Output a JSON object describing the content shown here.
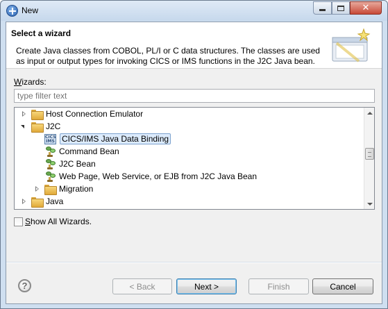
{
  "window": {
    "title": "New"
  },
  "header": {
    "title": "Select a wizard",
    "description": "Create Java classes from COBOL, PL/I or C data structures. The classes are used as input or output types for invoking CICS or IMS functions in the J2C Java bean."
  },
  "wizards": {
    "label_prefix": "W",
    "label_rest": "izards:",
    "filter_placeholder": "type filter text",
    "items": [
      {
        "label": "Host Connection Emulator",
        "icon": "folder-icon",
        "state": "collapsed"
      },
      {
        "label": "J2C",
        "icon": "folder-icon",
        "state": "expanded"
      },
      {
        "label": "CICS/IMS Java Data Binding",
        "icon": "cics-ims-icon",
        "selected": true
      },
      {
        "label": "Command Bean",
        "icon": "bean-icon"
      },
      {
        "label": "J2C Bean",
        "icon": "bean-icon"
      },
      {
        "label": "Web Page, Web Service, or EJB from J2C Java Bean",
        "icon": "bean-icon"
      },
      {
        "label": "Migration",
        "icon": "folder-icon",
        "state": "collapsed"
      },
      {
        "label": "Java",
        "icon": "folder-icon",
        "state": "collapsed"
      }
    ]
  },
  "show_all": {
    "label_prefix": "S",
    "label_rest": "how All Wizards."
  },
  "buttons": {
    "back": {
      "label": "< Back",
      "enabled": false
    },
    "next": {
      "label": "Next >",
      "enabled": true
    },
    "finish": {
      "label": "Finish",
      "enabled": false
    },
    "cancel": {
      "label": "Cancel",
      "enabled": true
    }
  },
  "colors": {
    "selection_bg": "#dcebfc",
    "selection_border": "#7da2ce",
    "dialog_bg": "#f0f0f0"
  }
}
